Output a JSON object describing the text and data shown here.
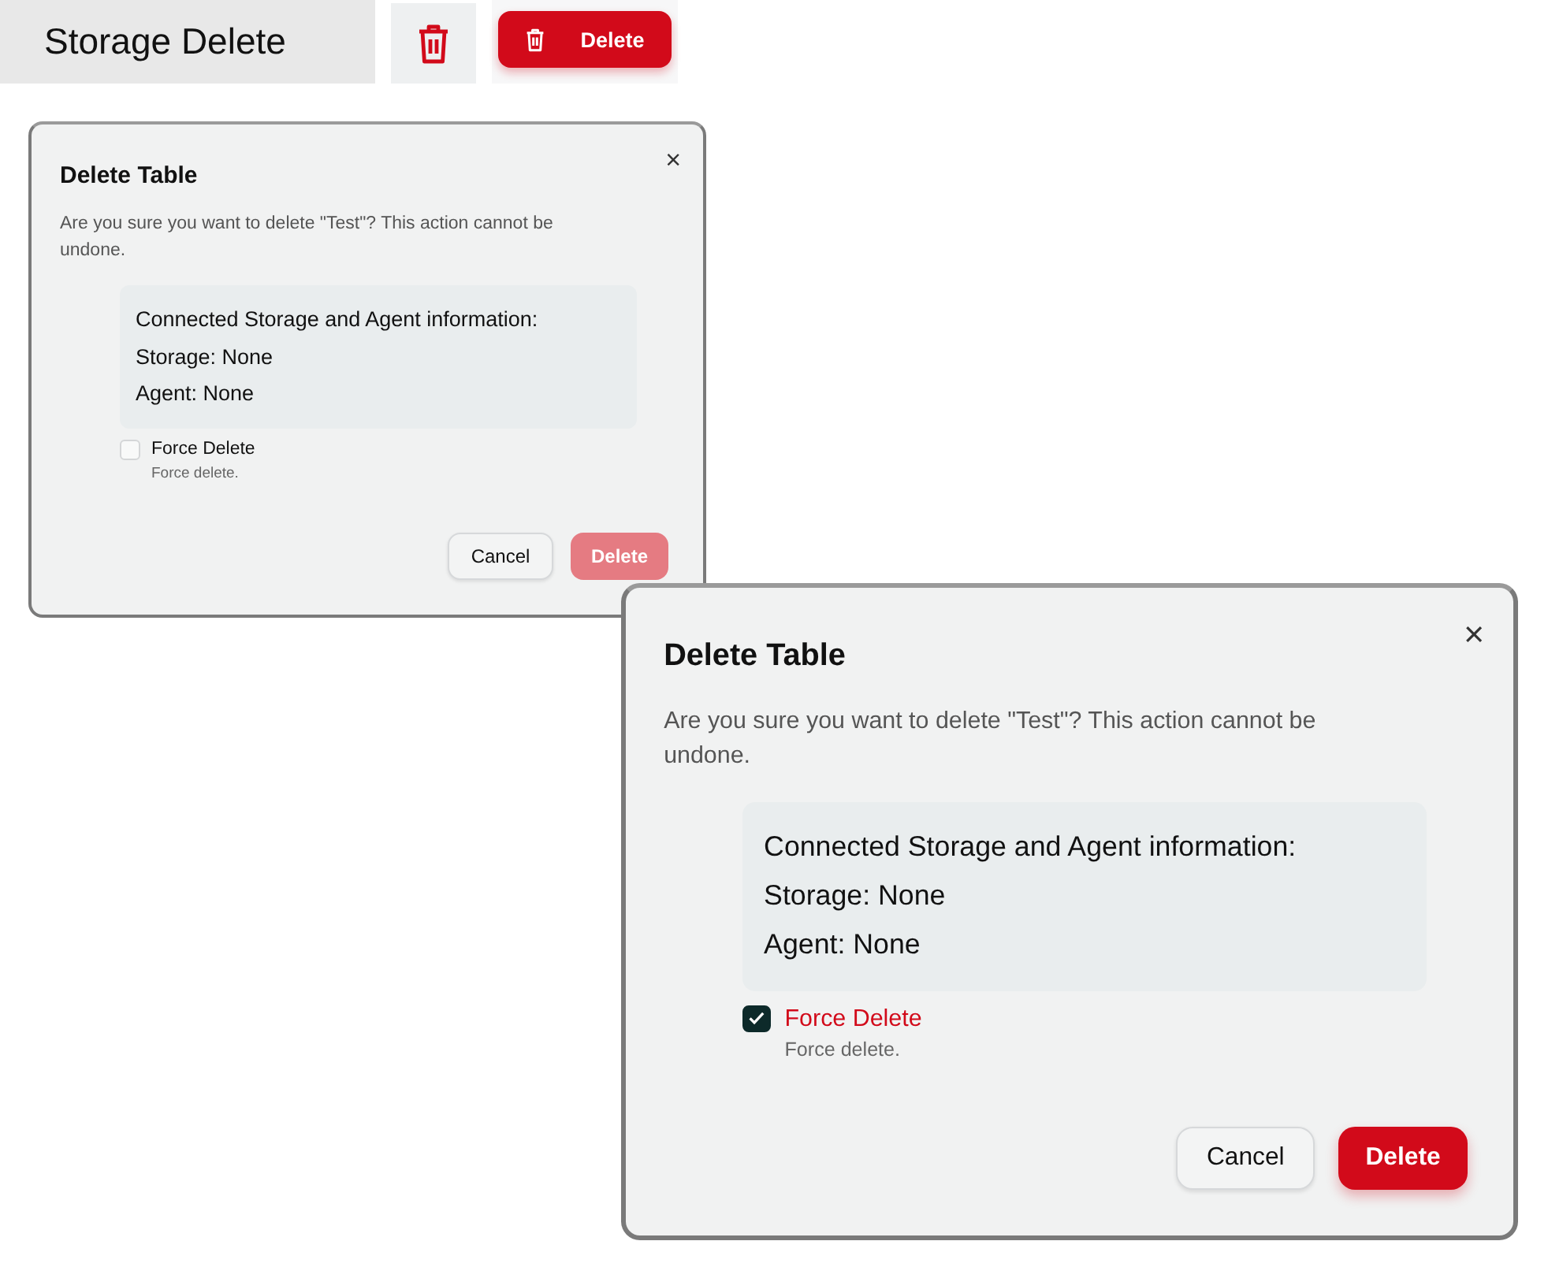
{
  "header": {
    "title": "Storage Delete",
    "button": "Delete"
  },
  "dialogs": [
    {
      "title": "Delete Table",
      "close": "×",
      "message": "Are you sure you want to delete \"Test\"? This action cannot be undone.",
      "info": {
        "heading": "Connected Storage and Agent information:",
        "lines": [
          "Storage: None",
          "Agent: None"
        ]
      },
      "force": {
        "label": "Force Delete",
        "hint": "Force delete.",
        "checked": false
      },
      "cancel": "Cancel",
      "confirm": {
        "label": "Delete",
        "disabled": true
      }
    },
    {
      "title": "Delete Table",
      "close": "×",
      "message": "Are you sure you want to delete \"Test\"? This action cannot be undone.",
      "info": {
        "heading": "Connected Storage and Agent information:",
        "lines": [
          "Storage: None",
          "Agent: None"
        ]
      },
      "force": {
        "label": "Force Delete",
        "hint": "Force delete.",
        "checked": true
      },
      "cancel": "Cancel",
      "confirm": {
        "label": "Delete",
        "disabled": false
      }
    }
  ]
}
